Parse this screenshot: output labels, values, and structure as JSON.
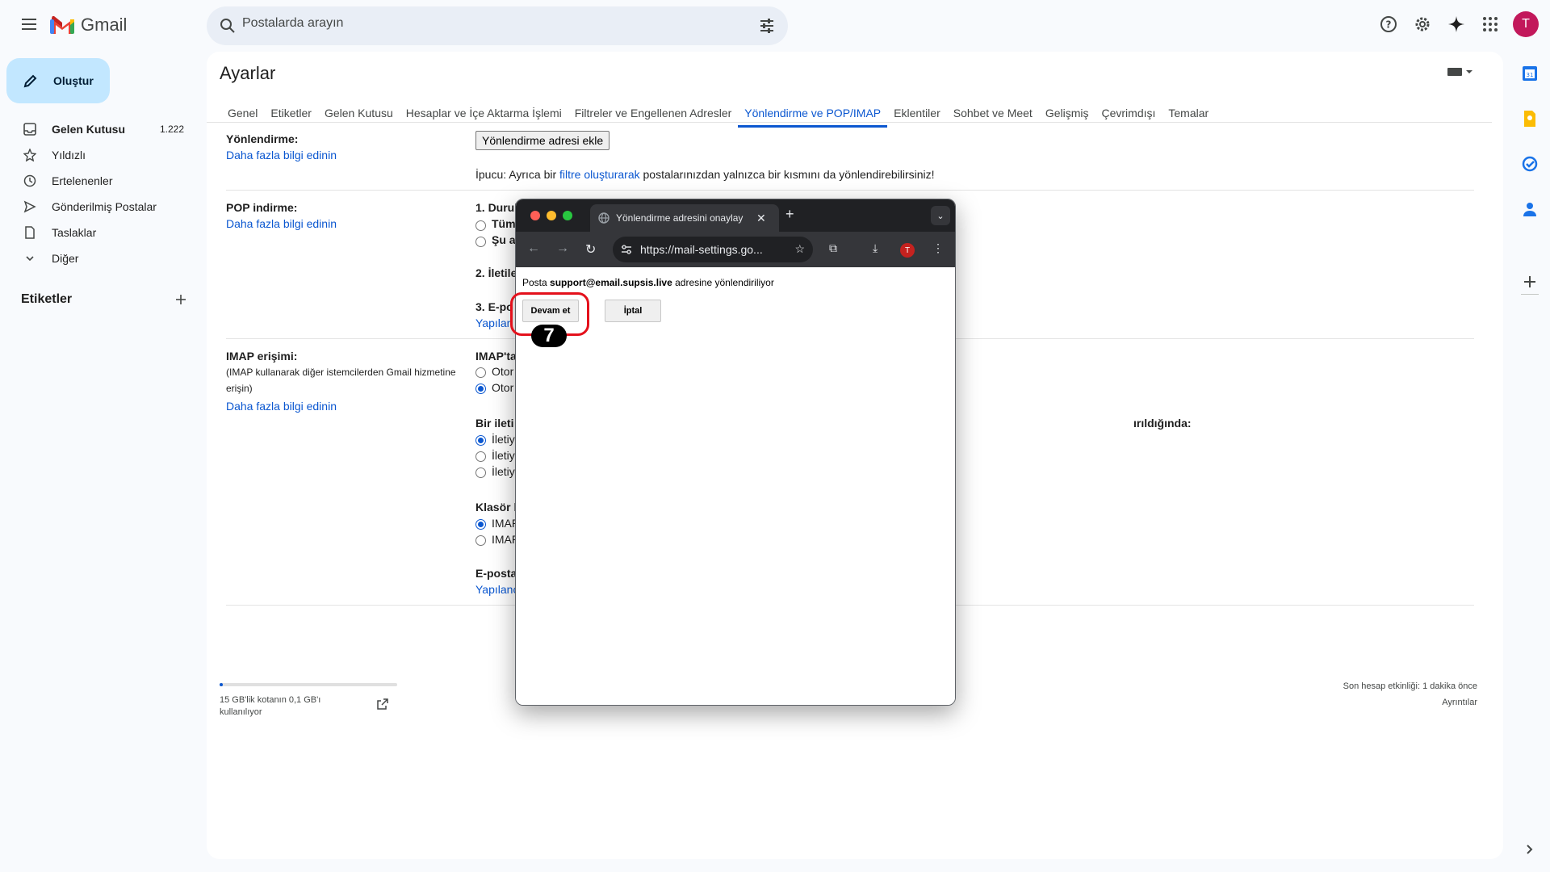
{
  "app": {
    "name": "Gmail"
  },
  "search": {
    "placeholder": "Postalarda arayın"
  },
  "user": {
    "avatar_letter": "T"
  },
  "colors": {
    "accent": "#0b57d0",
    "compose_bg": "#c2e7ff",
    "avatar": "#c2185b",
    "highlight": "#e4111c"
  },
  "sidebar": {
    "compose_label": "Oluştur",
    "items": [
      {
        "label": "Gelen Kutusu",
        "count": "1.222",
        "icon": "inbox-icon"
      },
      {
        "label": "Yıldızlı",
        "icon": "star-icon"
      },
      {
        "label": "Ertelenenler",
        "icon": "clock-icon"
      },
      {
        "label": "Gönderilmiş Postalar",
        "icon": "send-icon"
      },
      {
        "label": "Taslaklar",
        "icon": "draft-icon"
      },
      {
        "label": "Diğer",
        "icon": "chevron-down-icon"
      }
    ],
    "labels_heading": "Etiketler"
  },
  "settings": {
    "title": "Ayarlar",
    "tabs": [
      "Genel",
      "Etiketler",
      "Gelen Kutusu",
      "Hesaplar ve İçe Aktarma İşlemi",
      "Filtreler ve Engellenen Adresler",
      "Yönlendirme ve POP/IMAP",
      "Eklentiler",
      "Sohbet ve Meet",
      "Gelişmiş",
      "Çevrimdışı",
      "Temalar"
    ],
    "forwarding": {
      "label": "Yönlendirme:",
      "learn_more": "Daha fazla bilgi edinin",
      "add_button": "Yönlendirme adresi ekle",
      "tip_prefix": "İpucu: Ayrıca bir ",
      "tip_link": "filtre oluşturarak",
      "tip_suffix": " postalarınızdan yalnızca bir kısmını da yönlendirebilirsiniz!"
    },
    "pop": {
      "label": "POP indirme:",
      "learn_more": "Daha fazla bilgi edinin",
      "step1": "1. Durul",
      "opt1": "Tüm",
      "opt2": "Şu a",
      "step2": "2. İletile",
      "step3": "3. E-po",
      "config": "Yapılan"
    },
    "imap": {
      "label": "IMAP erişimi:",
      "desc": "(IMAP kullanarak diğer istemcilerden Gmail hizmetine erişin)",
      "learn_more": "Daha fazla bilgi edinin",
      "status_heading": "IMAP'ta",
      "auto1": "Otor",
      "auto2": "Otor",
      "delete_heading": "Bir ileti",
      "delete_suffix": "ırıldığında:",
      "msg1": "İletiy",
      "msg2": "İletiy",
      "msg3": "İletiy",
      "folder_heading": "Klasör l",
      "folder1": "IMAP",
      "folder2": "IMAP",
      "email_heading": "E-posta",
      "config": "Yapılanc"
    },
    "footer": {
      "storage": "15 GB'lik kotanın 0,1 GB'ı kullanılıyor",
      "storage_fraction": 0.0067,
      "activity": "Son hesap etkinliği: 1 dakika önce",
      "details": "Ayrıntılar"
    }
  },
  "popup": {
    "tab_title": "Yönlendirme adresini onaylay",
    "url": "https://mail-settings.go...",
    "profile_letter": "T",
    "message_prefix": "Posta ",
    "message_email": "support@email.supsis.live",
    "message_suffix": " adresine yönlendiriliyor",
    "continue_button": "Devam et",
    "cancel_button": "İptal",
    "step_number": "7"
  }
}
